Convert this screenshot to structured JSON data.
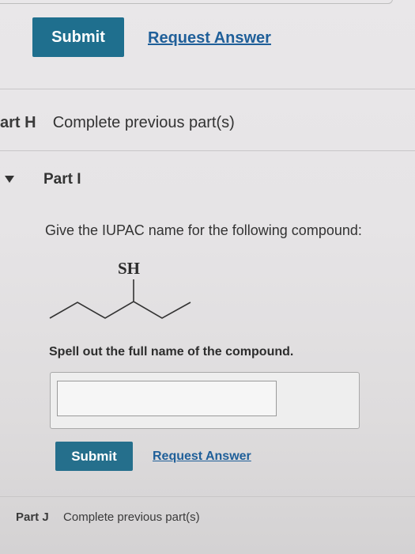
{
  "top_actions": {
    "submit_label": "Submit",
    "request_answer_label": "Request Answer"
  },
  "part_h": {
    "label": "art H",
    "status": "Complete previous part(s)"
  },
  "part_i": {
    "label": "Part I",
    "question": "Give the IUPAC name for the following compound:",
    "molecule": {
      "substituent_label": "SH"
    },
    "instruction": "Spell out the full name of the compound.",
    "answer_value": "",
    "submit_label": "Submit",
    "request_answer_label": "Request Answer"
  },
  "part_j": {
    "label": "Part J",
    "status": "Complete previous part(s)"
  },
  "colors": {
    "button": "#1f6f8e",
    "link": "#1f5f99"
  }
}
